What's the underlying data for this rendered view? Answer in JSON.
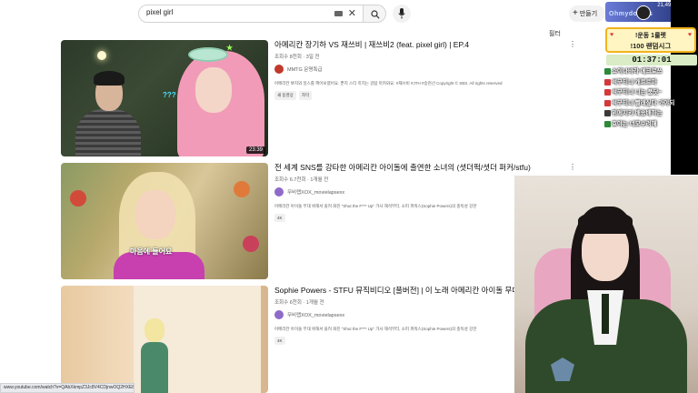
{
  "search": {
    "query": "pixel girl"
  },
  "header": {
    "create_label": "만들기"
  },
  "stream_counter": {
    "count_text": "21,492 / 21,000",
    "name_text": "Ohmydollers"
  },
  "filter_label": "필터",
  "videos": [
    {
      "title": "아메리칸 장기하 VS 재쓰비 | 재쓰비2 (feat. pixel girl) | EP.4",
      "meta": "조회수 8천회 · 3일 전",
      "channel": "MMTG 문명특급",
      "description": "아메리칸 뽀치와 일스를 핵어보였어요. 뿐지 스티 히지는 감탐 마카와요. #재쓰비 #JTH #승천선 Copyright © SBS. All rights reserved",
      "badges": [
        "새 동영상",
        "자막"
      ],
      "duration": "23:39",
      "overlay_text": "???"
    },
    {
      "title": "전 세계 SNS를 강타한 아메리칸 아이돌에 출연한 소녀의 (셧더퍽/셧더 퍼커/stfu)",
      "meta": "조회수 6.7천회 · 1개월 전",
      "channel": "무비랩XOX_movielapsexx",
      "description": "아메리칸 아이돌 무대 위해서 올려 화진 \"Shut the F*** Up\" 가사 해석부터, 소피 파워스(Sophie Powers)의 충독성 강한",
      "badges": [
        "4K"
      ],
      "duration": "",
      "overlay_text": "마음에 들어요"
    },
    {
      "title": "Sophie Powers - STFU 뮤직비디오 [풀버전] | 이 노래 아메리칸 아이돌 무대에",
      "meta": "조회수 6천회 · 1개월 전",
      "channel": "무비랩XOX_movielapsexx",
      "description": "아메리칸 아이돌 무대 위해서 올려 화진 \"Shut the F*** Up\" 가사 해석부터, 소피 파워스(Sophie Powers)의 충독성 강한",
      "badges": [
        "4K"
      ],
      "duration": "",
      "overlay_text": ""
    }
  ],
  "alert": {
    "line1": "!운동 1룰렛",
    "line2": "!100 랜덤시그"
  },
  "timer": "01:37:01",
  "chat": [
    {
      "text": "쇼이나바라 메크로쓰",
      "color": "#2d8a3a"
    },
    {
      "text": "석구티니 캐트르마",
      "color": "#d43a3a"
    },
    {
      "text": "석구티니 니는 풍닷~",
      "color": "#d43a3a"
    },
    {
      "text": "석구티니 빨래싶다 가야되",
      "color": "#d43a3a"
    },
    {
      "text": "위메지키 배송배하는",
      "color": "#3a3a3a"
    },
    {
      "text": "호야는 너모수려해",
      "color": "#2d8a3a"
    }
  ],
  "status_url": "www.youtube.com/watch?v=QAbXkmpZ3Jc8V4CDjnwOQ2HXE8Tk%3D%3D"
}
